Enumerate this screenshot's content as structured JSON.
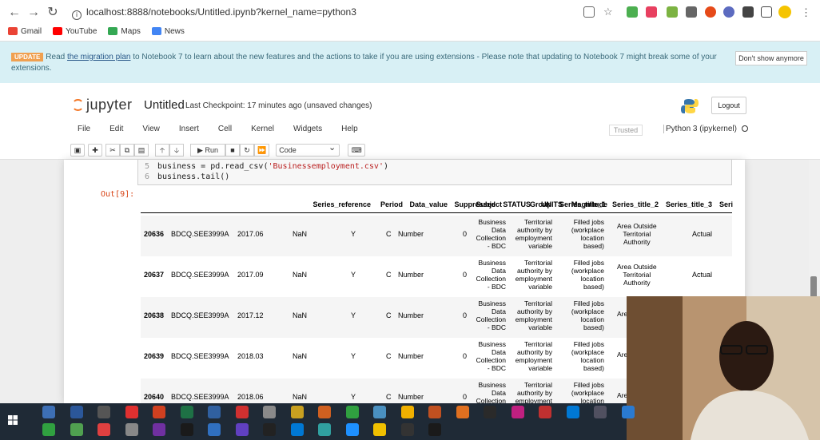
{
  "browser": {
    "url": "localhost:8888/notebooks/Untitled.ipynb?kernel_name=python3",
    "bookmarks": [
      {
        "label": "Gmail",
        "color": "#ea4335"
      },
      {
        "label": "YouTube",
        "color": "#ff0000"
      },
      {
        "label": "Maps",
        "color": "#34a853"
      },
      {
        "label": "News",
        "color": "#4285f4"
      }
    ]
  },
  "banner": {
    "tag": "UPDATE",
    "text_before": "Read ",
    "link": "the migration plan",
    "text_after": " to Notebook 7 to learn about the new features and the actions to take if you are using extensions - Please note that updating to Notebook 7 might break some of your extensions.",
    "dismiss": "Don't show anymore"
  },
  "jupyter": {
    "logo": "jupyter",
    "title": "Untitled",
    "checkpoint": "Last Checkpoint: 17 minutes ago  (unsaved changes)",
    "logout": "Logout",
    "menus": [
      "File",
      "Edit",
      "View",
      "Insert",
      "Cell",
      "Kernel",
      "Widgets",
      "Help"
    ],
    "trusted": "Trusted",
    "kernel": "Python 3 (ipykernel)",
    "toolbar": {
      "run": "▶ Run",
      "cell_type": "Code"
    }
  },
  "code": {
    "lines": [
      {
        "n": "5",
        "pre": "business = pd.read_csv(",
        "str": "'Businessemployment.csv'",
        "post": ")"
      },
      {
        "n": "6",
        "pre": "business.tail()",
        "str": "",
        "post": ""
      }
    ]
  },
  "output": {
    "prompt": "Out[9]:",
    "columns": [
      "Series_reference",
      "Period",
      "Data_value",
      "Suppressed",
      "STATUS",
      "UNITS",
      "Magnitude",
      "Subject",
      "Group",
      "Series_title_1",
      "Series_title_2",
      "Series_title_3",
      "Seri"
    ],
    "rows": [
      {
        "idx": "20636",
        "ref": "BDCQ.SEE3999A",
        "period": "2017.06",
        "value": "NaN",
        "supp": "Y",
        "status": "C",
        "units": "Number",
        "mag": "0",
        "subject": [
          "Business",
          "Data",
          "Collection",
          "- BDC"
        ],
        "group": [
          "Territorial",
          "authority by",
          "employment",
          "variable"
        ],
        "t1": [
          "Filled jobs",
          "(workplace",
          "location",
          "based)"
        ],
        "t2": [
          "Area Outside",
          "Territorial",
          "Authority"
        ],
        "t3": "Actual"
      },
      {
        "idx": "20637",
        "ref": "BDCQ.SEE3999A",
        "period": "2017.09",
        "value": "NaN",
        "supp": "Y",
        "status": "C",
        "units": "Number",
        "mag": "0",
        "subject": [
          "Business",
          "Data",
          "Collection",
          "- BDC"
        ],
        "group": [
          "Territorial",
          "authority by",
          "employment",
          "variable"
        ],
        "t1": [
          "Filled jobs",
          "(workplace",
          "location",
          "based)"
        ],
        "t2": [
          "Area Outside",
          "Territorial",
          "Authority"
        ],
        "t3": "Actual"
      },
      {
        "idx": "20638",
        "ref": "BDCQ.SEE3999A",
        "period": "2017.12",
        "value": "NaN",
        "supp": "Y",
        "status": "C",
        "units": "Number",
        "mag": "0",
        "subject": [
          "Business",
          "Data",
          "Collection",
          "- BDC"
        ],
        "group": [
          "Territorial",
          "authority by",
          "employment",
          "variable"
        ],
        "t1": [
          "Filled jobs",
          "(workplace",
          "location",
          "based)"
        ],
        "t2": [
          "Are"
        ],
        "t3": ""
      },
      {
        "idx": "20639",
        "ref": "BDCQ.SEE3999A",
        "period": "2018.03",
        "value": "NaN",
        "supp": "Y",
        "status": "C",
        "units": "Number",
        "mag": "0",
        "subject": [
          "Business",
          "Data",
          "Collection",
          "- BDC"
        ],
        "group": [
          "Territorial",
          "authority by",
          "employment",
          "variable"
        ],
        "t1": [
          "Filled jobs",
          "(workplace",
          "location",
          "based)"
        ],
        "t2": [
          "Are"
        ],
        "t3": ""
      },
      {
        "idx": "20640",
        "ref": "BDCQ.SEE3999A",
        "period": "2018.06",
        "value": "NaN",
        "supp": "Y",
        "status": "C",
        "units": "Number",
        "mag": "0",
        "subject": [
          "Business",
          "Data",
          "Collection"
        ],
        "group": [
          "Territorial",
          "authority by",
          "employment"
        ],
        "t1": [
          "Filled jobs",
          "(workplace",
          "location"
        ],
        "t2": [
          "Are"
        ],
        "t3": ""
      }
    ]
  },
  "taskbar": {
    "icons_row1": [
      "#3d6fb5",
      "#2b579a",
      "#555",
      "#e03030",
      "#d04020",
      "#1e7145",
      "#3060a0",
      "#d03030",
      "#8a8a8a",
      "#c8a020",
      "#d06020",
      "#30a040",
      "#4a90c0",
      "#f0b000",
      "#c05020",
      "#e07020",
      "#2a2a2a",
      "#c02080",
      "#c03030",
      "#0078d4",
      "#505060",
      "#2a7ad0"
    ],
    "icons_row2": [
      "#30a040",
      "#50a050",
      "#e04040",
      "#888",
      "#7030a0",
      "#1a1a1a",
      "#3070c0",
      "#6040c0",
      "#222",
      "#0078d4",
      "#30a0a0",
      "#1e90ff",
      "#f0c000",
      "#333",
      "#1a1a1a"
    ]
  }
}
